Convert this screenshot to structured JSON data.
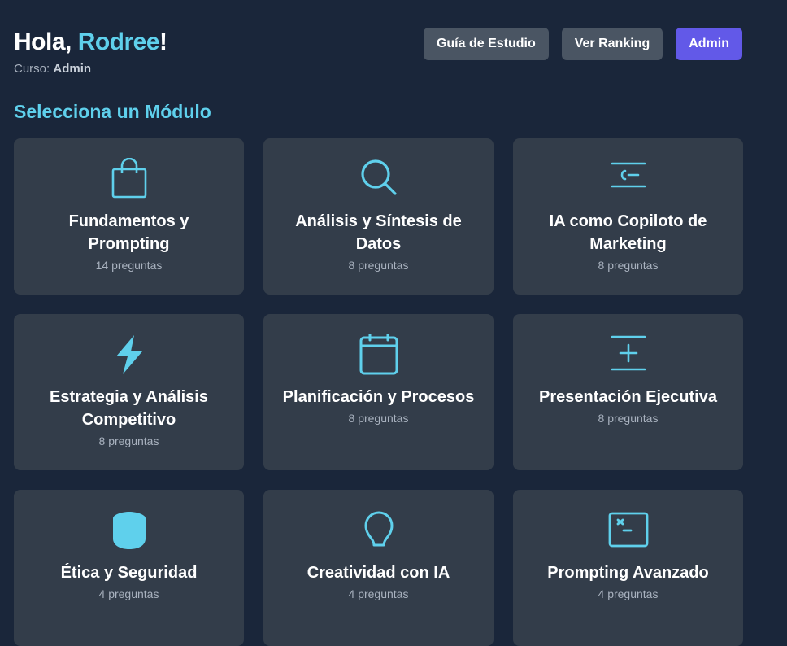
{
  "header": {
    "greeting_prefix": "Hola, ",
    "user_name": "Rodree",
    "greeting_suffix": "!",
    "course_label": "Curso: ",
    "course_value": "Admin"
  },
  "actions": {
    "study_guide": "Guía de Estudio",
    "ranking": "Ver Ranking",
    "admin": "Admin"
  },
  "section_title": "Selecciona un Módulo",
  "colors": {
    "accent": "#5fd0ec",
    "primary_button": "#6259e8",
    "background": "#1a263a",
    "card": "#333d4a"
  },
  "modules": [
    {
      "title": "Fundamentos y Prompting",
      "count": "14 preguntas",
      "icon": "shopping-bag-icon"
    },
    {
      "title": "Análisis y Síntesis de Datos",
      "count": "8 preguntas",
      "icon": "search-icon"
    },
    {
      "title": "IA como Copiloto de Marketing",
      "count": "8 preguntas",
      "icon": "text-lines-icon"
    },
    {
      "title": "Estrategia y Análisis Competitivo",
      "count": "8 preguntas",
      "icon": "lightning-icon"
    },
    {
      "title": "Planificación y Procesos",
      "count": "8 preguntas",
      "icon": "calendar-icon"
    },
    {
      "title": "Presentación Ejecutiva",
      "count": "8 preguntas",
      "icon": "presentation-icon"
    },
    {
      "title": "Ética y Seguridad",
      "count": "4 preguntas",
      "icon": "shield-icon"
    },
    {
      "title": "Creatividad con IA",
      "count": "4 preguntas",
      "icon": "lightbulb-icon"
    },
    {
      "title": "Prompting Avanzado",
      "count": "4 preguntas",
      "icon": "terminal-icon"
    }
  ]
}
